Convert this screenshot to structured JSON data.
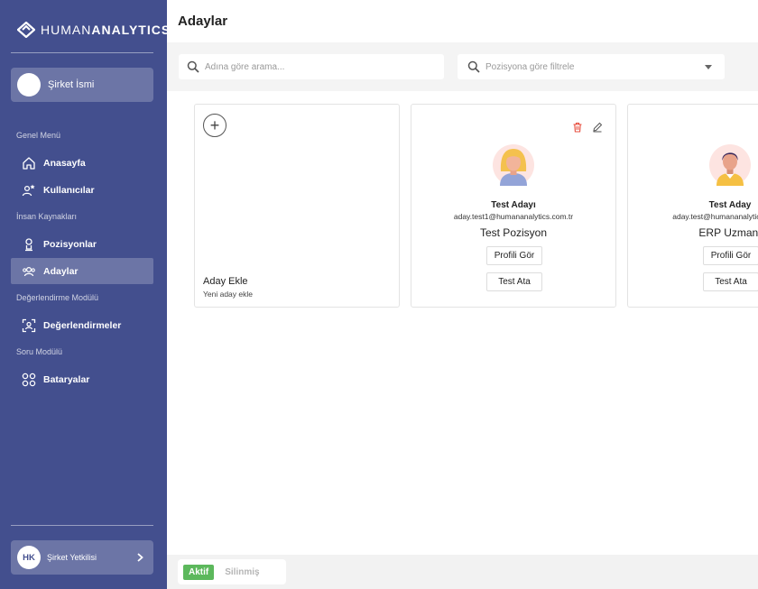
{
  "brand": {
    "name_part1": "HUMAN",
    "name_part2": "ANALYTICS"
  },
  "company": {
    "name": "Şirket İsmi"
  },
  "menu": {
    "sections": [
      {
        "title": "Genel Menü",
        "items": [
          {
            "label": "Anasayfa",
            "icon": "home-icon"
          },
          {
            "label": "Kullanıcılar",
            "icon": "users-gear-icon"
          }
        ]
      },
      {
        "title": "İnsan Kaynakları",
        "items": [
          {
            "label": "Pozisyonlar",
            "icon": "person-icon"
          },
          {
            "label": "Adaylar",
            "icon": "group-icon",
            "active": true
          }
        ]
      },
      {
        "title": "Değerlendirme Modülü",
        "items": [
          {
            "label": "Değerlendirmeler",
            "icon": "face-scan-icon"
          }
        ]
      },
      {
        "title": "Soru Modülü",
        "items": [
          {
            "label": "Bataryalar",
            "icon": "grid-circles-icon"
          }
        ]
      }
    ]
  },
  "user": {
    "initials": "HK",
    "role": "Şirket Yetkilisi"
  },
  "page": {
    "title": "Adaylar"
  },
  "filters": {
    "search_placeholder": "Adına göre arama...",
    "position_placeholder": "Pozisyona göre filtrele"
  },
  "add_card": {
    "title": "Aday Ekle",
    "subtitle": "Yeni aday ekle"
  },
  "candidates": [
    {
      "name": "Test Adayı",
      "email": "aday.test1@humananalytics.com.tr",
      "position": "Test Pozisyon",
      "profile_label": "Profili Gör",
      "assign_label": "Test Ata",
      "avatar": "female-avatar-icon"
    },
    {
      "name": "Test Aday",
      "email": "aday.test@humananalytics.com.tr",
      "position": "ERP Uzmanı",
      "profile_label": "Profili Gör",
      "assign_label": "Test Ata",
      "avatar": "male-avatar-icon"
    }
  ],
  "status_tabs": {
    "active": "Aktif",
    "deleted": "Silinmiş"
  },
  "colors": {
    "sidebar": "#434f8e",
    "active_tab": "#5cb85c",
    "delete": "#e74c3c"
  }
}
